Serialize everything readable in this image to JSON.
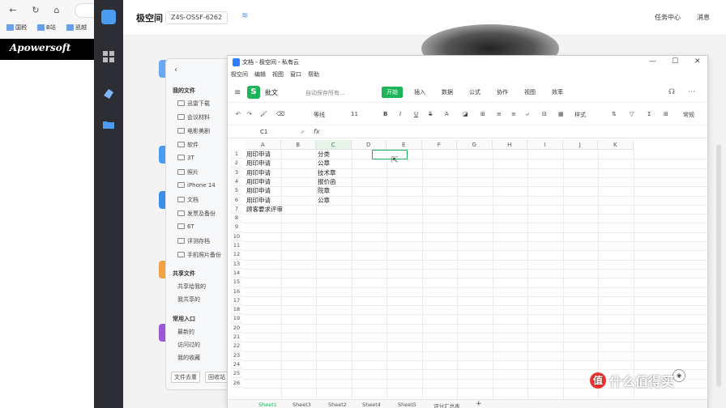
{
  "browser": {
    "bookmarks": [
      "国税",
      "B站",
      "凯越"
    ],
    "apowersoft_logo": "Apowersoft"
  },
  "app": {
    "title": "极空间",
    "device": "Z4S-OSSF-6262",
    "task_center": "任务中心",
    "messages": "消息"
  },
  "file_manager": {
    "my_files_section": "我的文件",
    "folders": [
      "迅雷下载",
      "会议材料",
      "电影美剧",
      "软件",
      "3T",
      "照片",
      "iPhone 14",
      "文档",
      "发票及备份",
      "6T",
      "评测存档",
      "手机照片备份"
    ],
    "shared_section": "共享文件",
    "shared_items": [
      "共享给我的",
      "我共享的"
    ],
    "common_section": "常用入口",
    "common_items": [
      "最新的",
      "访问过的",
      "我的收藏"
    ],
    "bottom_buttons": [
      "文件去重",
      "回收站"
    ]
  },
  "spreadsheet": {
    "window_title": "文档 - 极空间 - 私有云",
    "menu": [
      "极空间",
      "编辑",
      "视图",
      "窗口",
      "帮助"
    ],
    "doc_name": "批文",
    "autosave": "自动保存所有...",
    "tabs": [
      {
        "label": "开始",
        "active": true
      },
      {
        "label": "插入",
        "active": false
      },
      {
        "label": "数据",
        "active": false
      },
      {
        "label": "公式",
        "active": false
      },
      {
        "label": "协作",
        "active": false
      },
      {
        "label": "视图",
        "active": false
      },
      {
        "label": "效率",
        "active": false
      }
    ],
    "toolbar": {
      "font": "等线",
      "font_size": "11",
      "style_label": "样式",
      "right_label": "常规"
    },
    "name_box": "C1",
    "columns": [
      "A",
      "B",
      "C",
      "D",
      "E",
      "F",
      "G",
      "H",
      "I",
      "J",
      "K"
    ],
    "selected_column": "C",
    "rows": [
      "1",
      "2",
      "3",
      "4",
      "5",
      "6",
      "7",
      "8",
      "9",
      "10",
      "11",
      "12",
      "13",
      "14",
      "15",
      "16",
      "17",
      "18",
      "19",
      "20",
      "21",
      "22",
      "23",
      "24",
      "25",
      "26"
    ],
    "cells": [
      {
        "a": "用印申请",
        "b": "分类"
      },
      {
        "a": "用印申请",
        "b": "公章"
      },
      {
        "a": "用印申请",
        "b": "技术章"
      },
      {
        "a": "用印申请",
        "b": "报价函"
      },
      {
        "a": "用印申请",
        "b": "院章"
      },
      {
        "a": "用印申请",
        "b": "公章"
      },
      {
        "a": "顾客要求评审",
        "b": ""
      }
    ],
    "sheets": [
      {
        "label": "Sheet1",
        "active": true
      },
      {
        "label": "Sheet3",
        "active": false
      },
      {
        "label": "Sheet2",
        "active": false
      },
      {
        "label": "Sheet4",
        "active": false
      },
      {
        "label": "Sheet5",
        "active": false
      },
      {
        "label": "评分汇总表",
        "active": false
      }
    ]
  },
  "watermark": {
    "badge": "值",
    "text": "什么值得买"
  }
}
